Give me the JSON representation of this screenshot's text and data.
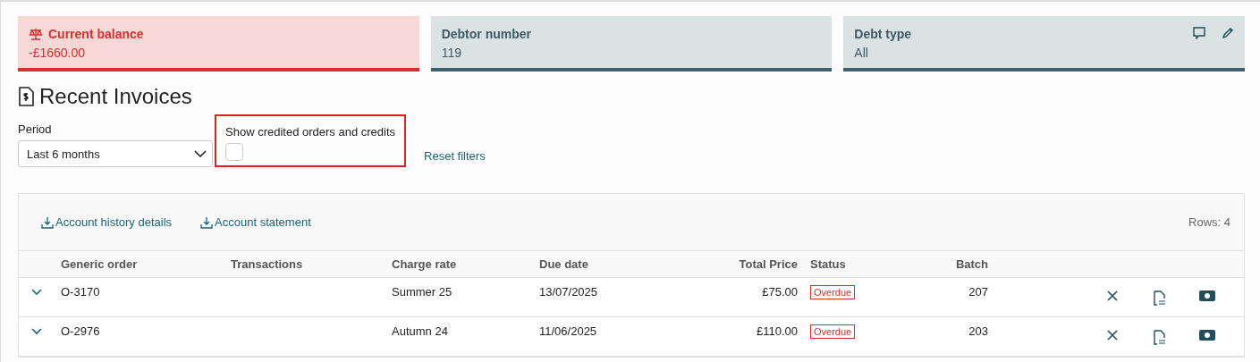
{
  "cards": [
    {
      "kind": "alert",
      "label": "Current balance",
      "value": "-£1660.00",
      "actions": false
    },
    {
      "kind": "info",
      "label": "Debtor number",
      "value": "119",
      "actions": false
    },
    {
      "kind": "info",
      "label": "Debt type",
      "value": "All",
      "actions": true
    }
  ],
  "section": {
    "title": "Recent Invoices"
  },
  "filters": {
    "period_label": "Period",
    "period_value": "Last 6 months",
    "credits_label": "Show credited orders and credits",
    "credits_checked": false,
    "credits_highlighted": true,
    "reset": "Reset filters"
  },
  "toolbar": {
    "links": [
      "Account history details",
      "Account statement"
    ],
    "rows": "Rows: 4"
  },
  "table": {
    "columns": [
      "Generic order",
      "Transactions",
      "Charge rate",
      "Due date",
      "Total Price",
      "Status",
      "Batch"
    ],
    "rows": [
      {
        "expanded": false,
        "order": "O-3170",
        "charge_rate": "Summer 25",
        "due_date": "13/07/2025",
        "total": "£75.00",
        "status": {
          "kind": "overdue",
          "label": "Overdue"
        },
        "batch": "207"
      },
      {
        "expanded": false,
        "order": "O-2976",
        "charge_rate": "Autumn 24",
        "due_date": "11/06/2025",
        "total": "£110.00",
        "status": {
          "kind": "overdue",
          "label": "Overdue"
        },
        "batch": "203"
      }
    ]
  }
}
